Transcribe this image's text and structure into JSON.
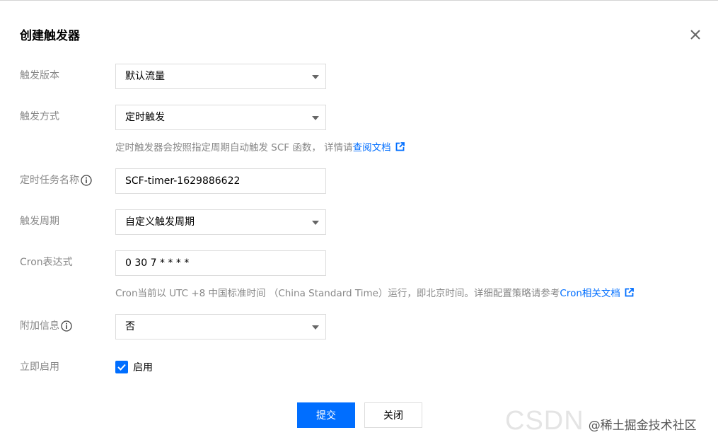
{
  "dialog": {
    "title": "创建触发器"
  },
  "form": {
    "version": {
      "label": "触发版本",
      "value": "默认流量"
    },
    "method": {
      "label": "触发方式",
      "value": "定时触发",
      "help_text": "定时触发器会按照指定周期自动触发 SCF 函数， 详情请",
      "help_link": "查阅文档"
    },
    "task_name": {
      "label": "定时任务名称",
      "value": "SCF-timer-1629886622"
    },
    "period": {
      "label": "触发周期",
      "value": "自定义触发周期"
    },
    "cron": {
      "label": "Cron表达式",
      "value": "0 30 7 * * * *",
      "help_text": "Cron当前以 UTC +8 中国标准时间 （China Standard Time）运行，即北京时间。详细配置策略请参考",
      "help_link": "Cron相关文档"
    },
    "extra_info": {
      "label": "附加信息",
      "value": "否"
    },
    "enable_now": {
      "label": "立即启用",
      "checkbox_label": "启用",
      "checked": true
    }
  },
  "footer": {
    "submit_label": "提交",
    "close_label": "关闭"
  },
  "watermark": {
    "brand": "CSDN",
    "author": "@稀土掘金技术社区"
  },
  "colors": {
    "primary": "#006eff",
    "label_gray": "#888888",
    "border": "#dcdcdc"
  },
  "icons": {
    "close": "close-icon",
    "info": "info-icon",
    "dropdown": "chevron-down-icon",
    "external": "external-link-icon",
    "check": "check-icon"
  }
}
